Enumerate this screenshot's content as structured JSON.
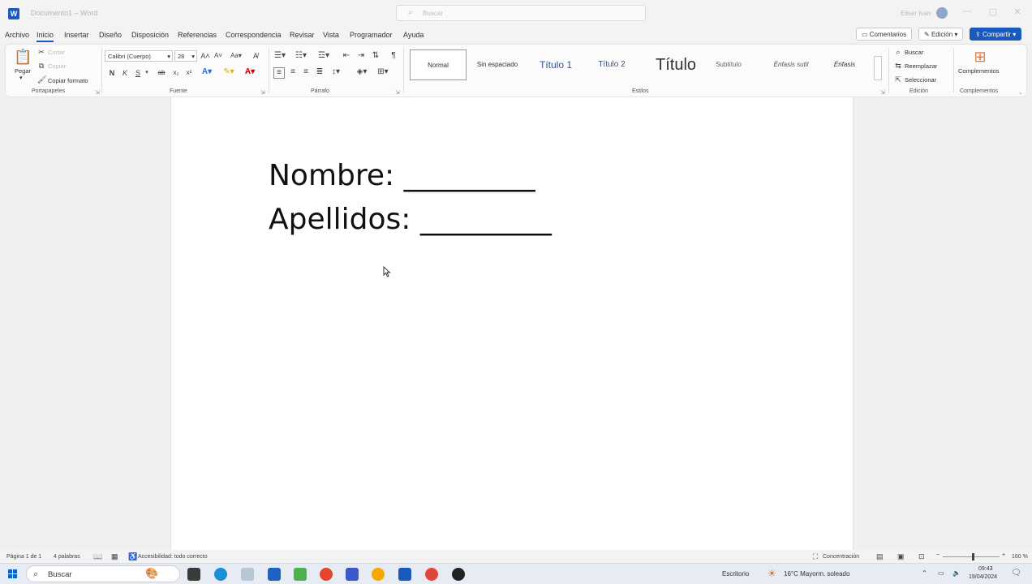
{
  "titlebar": {
    "doc_title": "Documento1 – Word",
    "search_placeholder": "Buscar",
    "user_name": "Eliser Ivan"
  },
  "menu": {
    "tabs": [
      "Archivo",
      "Inicio",
      "Insertar",
      "Diseño",
      "Disposición",
      "Referencias",
      "Correspondencia",
      "Revisar",
      "Vista",
      "Programador",
      "Ayuda"
    ],
    "active": "Inicio",
    "comments": "Comentarios",
    "edit_mode": "Edición",
    "share": "Compartir"
  },
  "ribbon": {
    "clipboard": {
      "paste": "Pegar",
      "cut": "Cortar",
      "copy": "Copiar",
      "format_painter": "Copiar formato",
      "label": "Portapapeles"
    },
    "font": {
      "name": "Calibri (Cuerpo)",
      "size": "28",
      "bold": "N",
      "italic": "K",
      "underline": "S",
      "label": "Fuente"
    },
    "paragraph": {
      "label": "Párrafo"
    },
    "styles": {
      "items": [
        "Normal",
        "Sin espaciado",
        "Título 1",
        "Título 2",
        "Título",
        "Subtítulo",
        "Énfasis sutil",
        "Énfasis"
      ],
      "label": "Estilos"
    },
    "editing": {
      "find": "Buscar",
      "replace": "Reemplazar",
      "select": "Seleccionar",
      "label": "Edición"
    },
    "addins": {
      "button": "Complementos",
      "label": "Complementos"
    }
  },
  "document": {
    "lines": [
      "Nombre: _________",
      "Apellidos: _________"
    ]
  },
  "status": {
    "page": "Página 1 de 1",
    "words": "4 palabras",
    "accessibility": "Accesibilidad: todo correcto",
    "focus": "Concentración",
    "zoom": "160 %"
  },
  "taskbar": {
    "search": "Buscar",
    "desktop": "Escritorio",
    "weather": "16°C  Mayorm. soleado",
    "time": "09:43",
    "date": "19/04/2024"
  },
  "colors": {
    "accent": "#185abd"
  }
}
